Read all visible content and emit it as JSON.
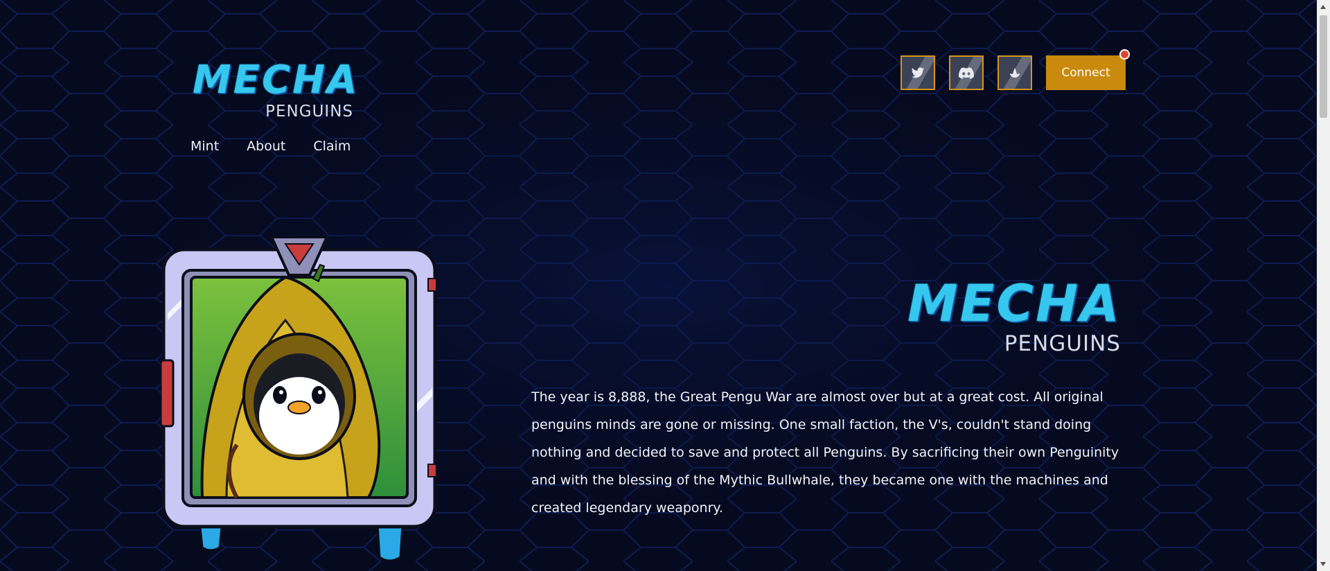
{
  "header": {
    "logo_word": "MECHA",
    "logo_sub": "PENGUINS",
    "nav": [
      "Mint",
      "About",
      "Claim"
    ],
    "social": [
      "twitter-icon",
      "discord-icon",
      "whale-icon"
    ],
    "connect_label": "Connect"
  },
  "hero": {
    "logo_word": "MECHA",
    "logo_sub": "PENGUINS",
    "story": "The year is 8,888, the Great Pengu War are almost over but at a great cost. All original penguins minds are gone or missing. One small faction, the V's, couldn't stand doing nothing and decided to save and protect all Penguins. By sacrificing their own Penguinity and with the blessing of the Mythic Bullwhale, they became one with the machines and created legendary weaponry."
  },
  "colors": {
    "background": "#060a1f",
    "accent": "#c98a0d",
    "logo": "#36c7ee",
    "notification": "#e0462e"
  }
}
